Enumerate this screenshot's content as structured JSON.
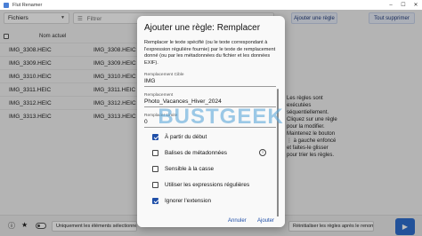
{
  "window": {
    "title": "Flut Renamer",
    "controls": [
      "–",
      "☐",
      "✕"
    ]
  },
  "toolbar": {
    "files_select": "Fichiers",
    "filter_placeholder": "Filtrer",
    "add_rule_button": "Ajouter une règle",
    "select_all_button": "Tout supprimer"
  },
  "files": {
    "header_old": "Nom actuel",
    "rows": [
      {
        "old": "IMG_3308.HEIC",
        "new": "IMG_3308.HEIC"
      },
      {
        "old": "IMG_3309.HEIC",
        "new": "IMG_3309.HEIC"
      },
      {
        "old": "IMG_3310.HEIC",
        "new": "IMG_3310.HEIC"
      },
      {
        "old": "IMG_3311.HEIC",
        "new": "IMG_3311.HEIC"
      },
      {
        "old": "IMG_3312.HEIC",
        "new": "IMG_3312.HEIC"
      },
      {
        "old": "IMG_3313.HEIC",
        "new": "IMG_3313.HEIC"
      }
    ]
  },
  "help_text": "Les règles sont exécutées séquentiellement. Cliquez sur une règle pour la modifier. Maintenez le bouton ⋮ à gauche enfoncé et faites-le glisser pour trier les règles.",
  "bottom": {
    "chip1": "Uniquement les éléments sélectionnés",
    "chip2": "Réinitialiser les règles après le renommage"
  },
  "dialog": {
    "title": "Ajouter une règle: Remplacer",
    "description": "Remplacer le texte spécifié (ou le texte correspondant à l'expression régulière fournie) par le texte de remplacement donné (ou par les métadonnées du fichier et les données EXIF).",
    "target_label": "Remplacement Cible",
    "target_value": "IMG",
    "replacement_label": "Remplacement",
    "replacement_value": "Photo_Vacances_Hiver_2024",
    "limit_label": "Remplacer Limite",
    "limit_value": "0",
    "options": [
      {
        "label": "À partir du début",
        "checked": true
      },
      {
        "label": "Balises de métadonnées",
        "checked": false
      },
      {
        "label": "Sensible à la casse",
        "checked": false
      },
      {
        "label": "Utiliser les expressions régulières",
        "checked": false
      },
      {
        "label": "Ignorer l'extension",
        "checked": true
      }
    ],
    "cancel": "Annuler",
    "add": "Ajouter"
  },
  "watermark": "BUSTGEEK"
}
